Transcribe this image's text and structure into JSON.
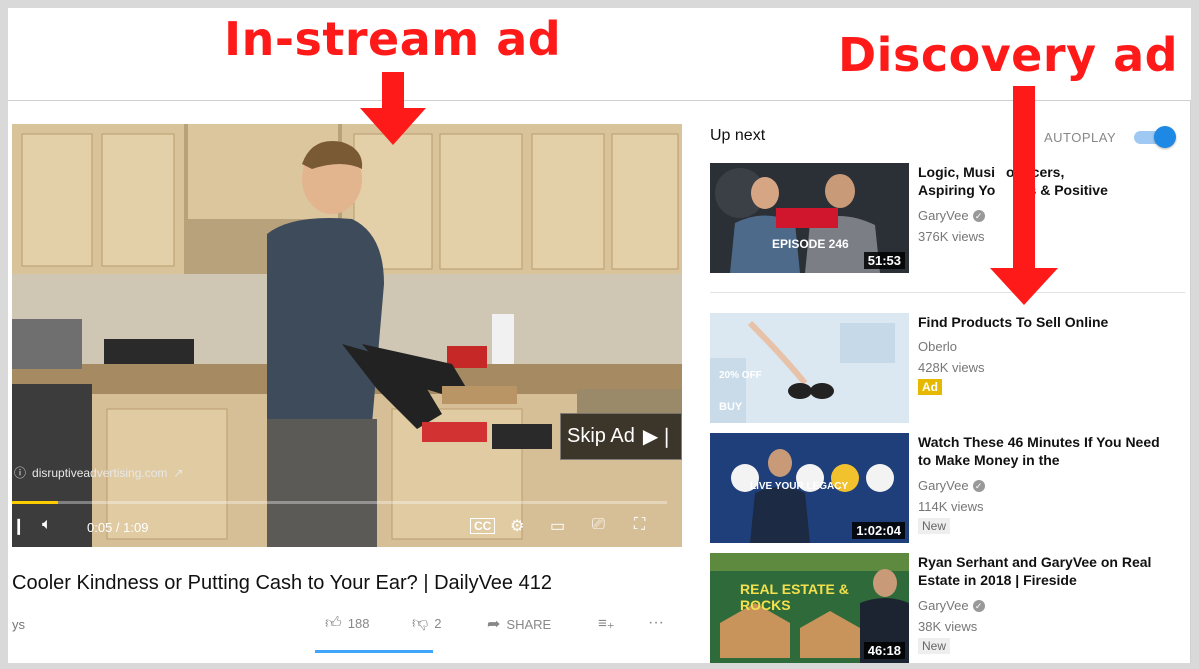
{
  "annotations": {
    "instream_label": "In-stream ad",
    "discovery_label": "Discovery ad",
    "arrow_color": "#ff1a1a"
  },
  "player": {
    "skip_label": "Skip Ad",
    "skip_icon": "skip-next-icon",
    "advertiser_url": "disruptiveadvertising.com",
    "time": "0:05 / 1:09",
    "progress_fraction": 0.07,
    "progress_color": "#ffcc00",
    "controls": [
      "next-icon",
      "volume-icon",
      "captions-icon",
      "settings-icon",
      "theater-icon",
      "cast-icon",
      "fullscreen-icon"
    ]
  },
  "video": {
    "title": "Cooler Kindness or Putting Cash to Your Ear? | DailyVee 412",
    "channel_fragment": "ys",
    "likes": "188",
    "dislikes": "2",
    "share_label": "SHARE",
    "accent_color": "#3ea6ff"
  },
  "sidebar": {
    "up_next_label": "Up next",
    "autoplay_label": "AUTOPLAY",
    "autoplay_on": true,
    "items": [
      {
        "title": "Logic, Music Producers, Aspiring YouTubers & Positive",
        "title_visible_1": "Logic, Musi",
        "title_visible_1b": "oducers,",
        "title_visible_2": "Aspiring Yo",
        "title_visible_2b": "ers & Positive",
        "channel": "GaryVee",
        "views": "376K views",
        "duration": "51:53",
        "thumb_text": "EPISODE 246"
      },
      {
        "title": "Find Products To Sell Online",
        "channel": "Oberlo",
        "views": "428K views",
        "badge": "Ad",
        "thumb_text": "20% OFF",
        "thumb_text2": "BUY"
      },
      {
        "title": "Watch These 46 Minutes If You Need to Make Money in the",
        "channel": "GaryVee",
        "views": "114K views",
        "badge": "New",
        "duration": "1:02:04",
        "thumb_text": "LIVE YOUR LEGACY"
      },
      {
        "title": "Ryan Serhant and GaryVee on Real Estate in 2018 | Fireside",
        "channel": "GaryVee",
        "views": "38K views",
        "badge": "New",
        "duration": "46:18",
        "thumb_text": "REAL ESTATE & ROCKS"
      }
    ]
  }
}
